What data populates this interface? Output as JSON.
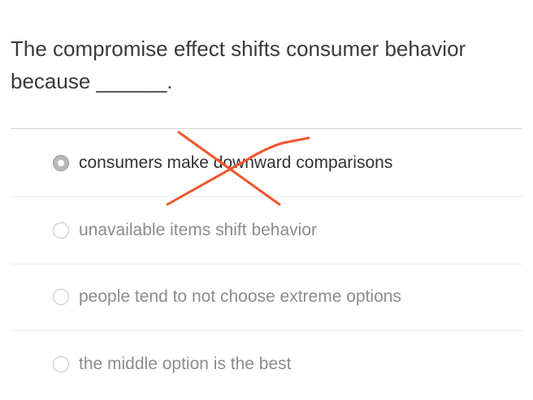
{
  "question": {
    "text": "The compromise effect shifts consumer behavior because ______."
  },
  "options": [
    {
      "label": "consumers make downward comparisons",
      "selected": true,
      "crossed_out": true
    },
    {
      "label": "unavailable items shift behavior",
      "selected": false,
      "crossed_out": false
    },
    {
      "label": "people tend to not choose extreme options",
      "selected": false,
      "crossed_out": false
    },
    {
      "label": "the middle option is the best",
      "selected": false,
      "crossed_out": false
    }
  ],
  "colors": {
    "annotation": "#f2552c",
    "text_active": "#333333",
    "text_inactive": "#8c8c8c"
  }
}
